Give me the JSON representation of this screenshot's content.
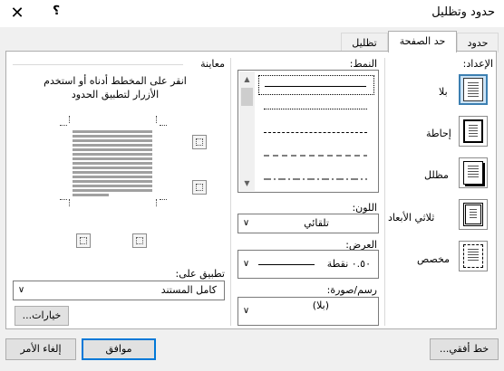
{
  "window": {
    "title": "حدود وتظليل",
    "close_glyph": "✕",
    "help_glyph": "؟"
  },
  "tabs": [
    {
      "label": "حدود",
      "active": false
    },
    {
      "label": "حد الصفحة",
      "active": true
    },
    {
      "label": "تظليل",
      "active": false
    }
  ],
  "setting": {
    "label": "الإعداد:",
    "options": [
      {
        "label": "بلا",
        "selected": true
      },
      {
        "label": "إحاطة",
        "selected": false
      },
      {
        "label": "مظلل",
        "selected": false
      },
      {
        "label": "ثلاثي الأبعاد",
        "selected": false
      },
      {
        "label": "مخصص",
        "selected": false
      }
    ]
  },
  "style": {
    "label": "النمط:",
    "items": [
      "solid",
      "dotted",
      "dashed-small",
      "dashed-large"
    ]
  },
  "color": {
    "label": "اللون:",
    "value": "تلقائي"
  },
  "width": {
    "label": "العرض:",
    "value": "٠.٥٠ نقطة"
  },
  "art": {
    "label": "رسم/صورة:",
    "value": "(بلا)"
  },
  "preview": {
    "label": "معاينة",
    "instruction_line1": "انقر على المخطط أدناه أو استخدم",
    "instruction_line2": "الأزرار لتطبيق الحدود"
  },
  "apply_to": {
    "label": "تطبيق على:",
    "value": "كامل المستند"
  },
  "options_button": "خيارات...",
  "horizontal_line_button": "خط أفقي...",
  "ok_button": "موافق",
  "cancel_button": "إلغاء الأمر",
  "colors": {
    "accent": "#0078d7",
    "selected_bg": "#cce4f7"
  }
}
